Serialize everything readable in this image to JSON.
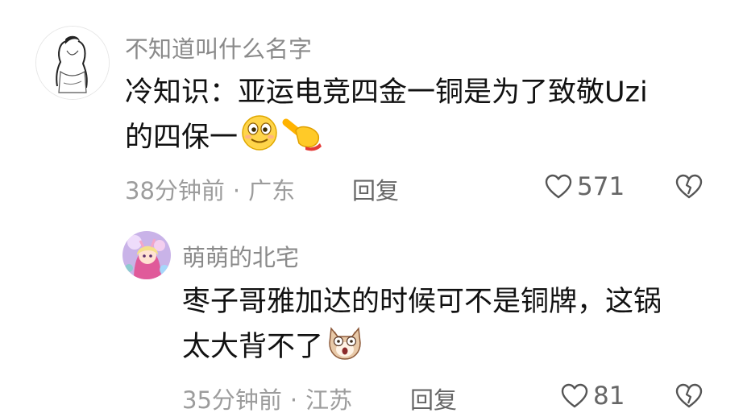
{
  "comment": {
    "username": "不知道叫什么名字",
    "text_line1": "冷知识：亚运电竞四金一铜是为了致敬Uzi",
    "text_line2": "的四保一",
    "emojis": [
      "smile-face-icon",
      "pointing-hand-icon"
    ],
    "time": "38分钟前",
    "location": "广东",
    "separator": "·",
    "reply_label": "回复",
    "like_count": "571"
  },
  "reply": {
    "username": "萌萌的北宅",
    "text_line1": "枣子哥雅加达的时候可不是铜牌，这锅",
    "text_line2": "太大背不了",
    "emojis": [
      "shocked-cat-icon"
    ],
    "time": "35分钟前",
    "location": "江苏",
    "separator": "·",
    "reply_label": "回复",
    "like_count": "81"
  }
}
